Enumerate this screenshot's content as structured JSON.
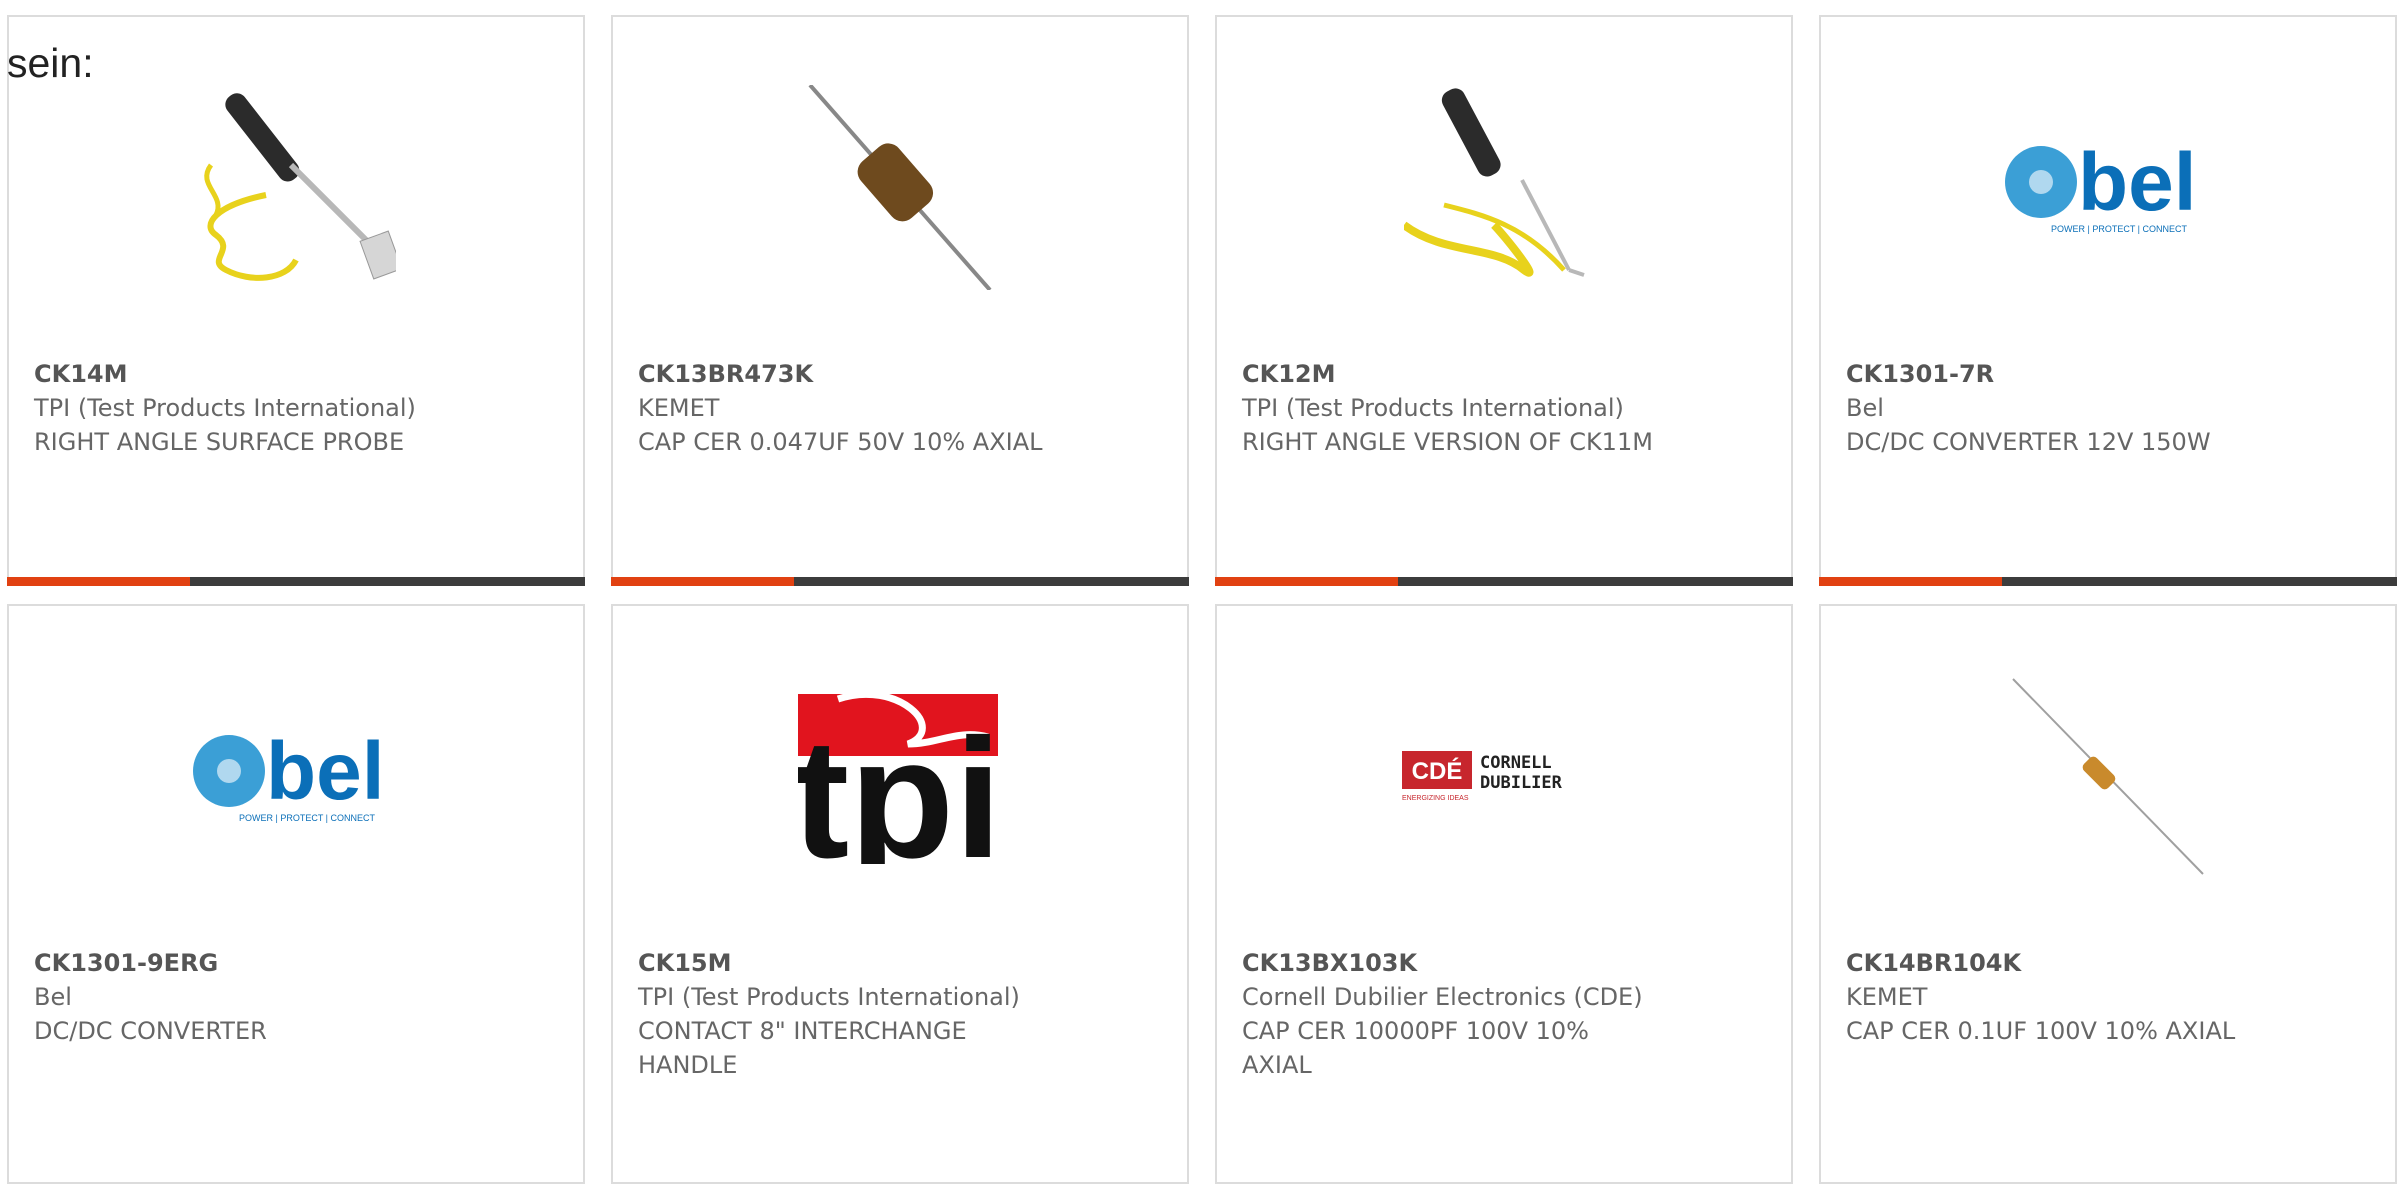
{
  "intro_text": "sein:",
  "colors": {
    "accent": "#e14111",
    "bar": "#3c3c3c",
    "border": "#dcdcdc",
    "text": "#666666"
  },
  "products": [
    {
      "part": "CK14M",
      "maker": "TPI (Test Products International)",
      "desc": "RIGHT ANGLE SURFACE PROBE",
      "image": "surface-probe-image"
    },
    {
      "part": "CK13BR473K",
      "maker": "KEMET",
      "desc": "CAP CER 0.047UF 50V 10% AXIAL",
      "image": "axial-capacitor-image"
    },
    {
      "part": "CK12M",
      "maker": "TPI (Test Products International)",
      "desc": "RIGHT ANGLE VERSION OF CK11M",
      "image": "right-angle-probe-image"
    },
    {
      "part": "CK1301-7R",
      "maker": "Bel",
      "desc": "DC/DC CONVERTER 12V 150W",
      "image": "bel-logo"
    },
    {
      "part": "CK1301-9ERG",
      "maker": "Bel",
      "desc": "DC/DC CONVERTER",
      "image": "bel-logo"
    },
    {
      "part": "CK15M",
      "maker": "TPI (Test Products International)",
      "desc": "CONTACT 8\" INTERCHANGE HANDLE",
      "image": "tpi-logo"
    },
    {
      "part": "CK13BX103K",
      "maker": "Cornell Dubilier Electronics (CDE)",
      "desc": "CAP CER 10000PF 100V 10% AXIAL",
      "image": "cde-logo"
    },
    {
      "part": "CK14BR104K",
      "maker": "KEMET",
      "desc": "CAP CER 0.1UF 100V 10% AXIAL",
      "image": "thin-axial-capacitor-image"
    }
  ],
  "logos": {
    "bel": {
      "word": "bel",
      "tagline": "POWER | PROTECT | CONNECT"
    },
    "tpi": {
      "word": "tpi"
    },
    "cde": {
      "mark": "CDÉ",
      "line1": "CORNELL",
      "line2": "DUBILIER",
      "tagline": "ENERGIZING IDEAS"
    }
  }
}
